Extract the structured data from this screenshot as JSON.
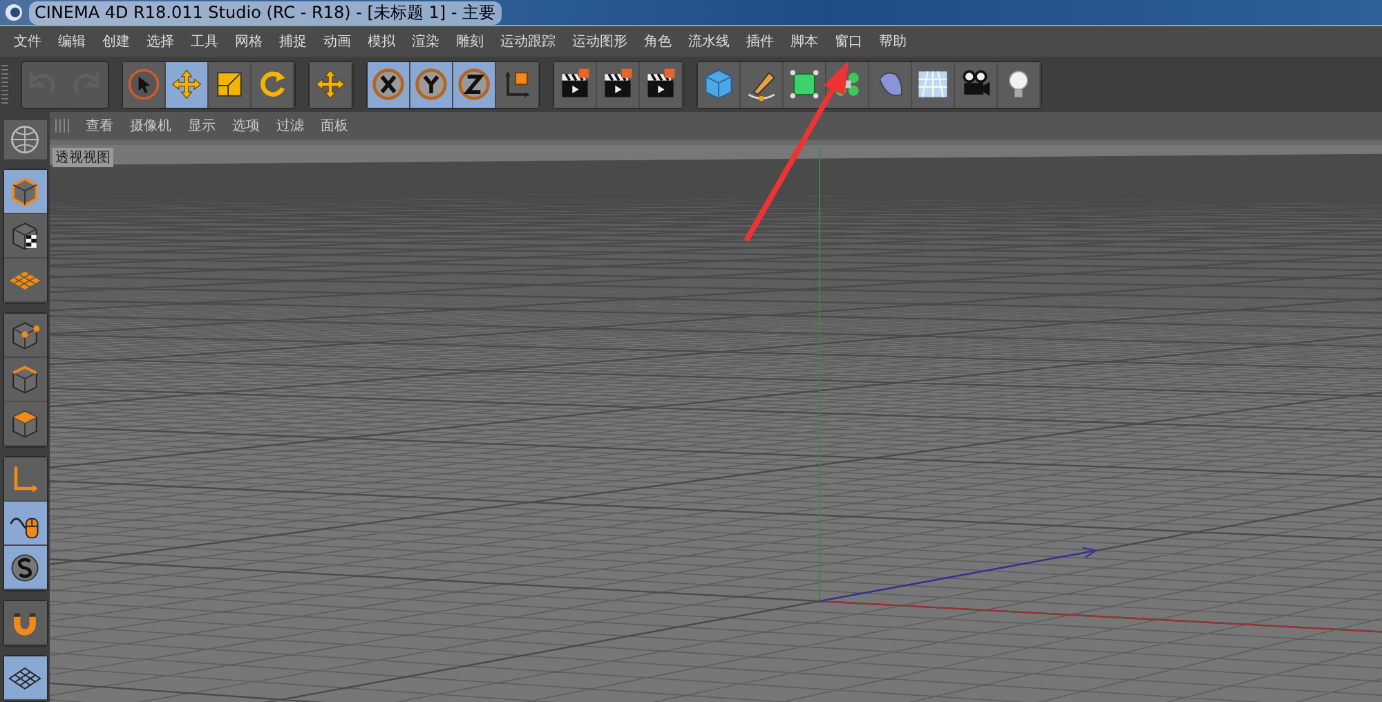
{
  "window": {
    "title": "CINEMA 4D R18.011 Studio (RC - R18) - [未标题 1] - 主要"
  },
  "menu": [
    "文件",
    "编辑",
    "创建",
    "选择",
    "工具",
    "网格",
    "捕捉",
    "动画",
    "模拟",
    "渲染",
    "雕刻",
    "运动跟踪",
    "运动图形",
    "角色",
    "流水线",
    "插件",
    "脚本",
    "窗口",
    "帮助"
  ],
  "toolbar": [
    {
      "buttons": [
        {
          "selected": false,
          "disabled": true
        },
        {
          "selected": false,
          "disabled": true
        }
      ]
    },
    {
      "buttons": [
        {
          "selected": false,
          "disabled": false
        },
        {
          "selected": true,
          "disabled": false
        },
        {
          "selected": false,
          "disabled": false
        },
        {
          "selected": false,
          "disabled": false
        }
      ]
    },
    {
      "buttons": [
        {
          "selected": false,
          "disabled": false
        }
      ]
    },
    {
      "buttons": [
        {
          "selected": true,
          "disabled": false
        },
        {
          "selected": true,
          "disabled": false
        },
        {
          "selected": true,
          "disabled": false
        },
        {
          "selected": false,
          "disabled": false
        }
      ]
    },
    {
      "buttons": [
        {
          "selected": false,
          "disabled": false
        },
        {
          "selected": false,
          "disabled": false
        },
        {
          "selected": false,
          "disabled": false
        }
      ]
    },
    {
      "buttons": [
        {
          "selected": false,
          "disabled": false
        },
        {
          "selected": false,
          "disabled": false
        },
        {
          "selected": false,
          "disabled": false
        },
        {
          "selected": false,
          "disabled": false
        },
        {
          "selected": false,
          "disabled": false
        },
        {
          "selected": false,
          "disabled": false
        },
        {
          "selected": false,
          "disabled": false
        },
        {
          "selected": false,
          "disabled": false
        }
      ]
    }
  ],
  "viewport_menu": [
    "查看",
    "摄像机",
    "显示",
    "选项",
    "过滤",
    "面板"
  ],
  "viewport": {
    "label": "透视视图"
  },
  "left_toolbar": [
    {
      "buttons": [
        {
          "selected": true
        },
        {
          "selected": false
        },
        {
          "selected": false
        }
      ]
    },
    {
      "buttons": [
        {
          "selected": false
        },
        {
          "selected": false
        },
        {
          "selected": false
        }
      ]
    },
    {
      "buttons": [
        {
          "selected": false
        },
        {
          "selected": true
        },
        {
          "selected": true
        }
      ]
    },
    {
      "buttons": [
        {
          "selected": false
        }
      ]
    },
    {
      "buttons": [
        {
          "selected": true
        }
      ]
    }
  ]
}
